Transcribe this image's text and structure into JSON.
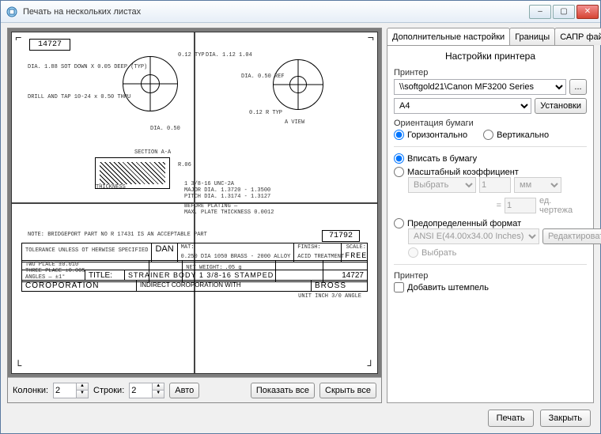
{
  "window": {
    "title": "Печать на нескольких листах"
  },
  "drawing": {
    "part_no_top": "14727",
    "part_no_right": "71792",
    "note": "NOTE: BRIDGEPORT PART NO R 17431 IS AN ACCEPTABLE PART",
    "title_label": "TITLE:",
    "title_value": "STRAINER BODY 1 3/8-16 STAMPED",
    "scale_label": "SCALE:",
    "free": "FREE",
    "finish_label": "FINISH:",
    "matl_label": "MAT:",
    "matl_value": "0.250 DIA 1050 BRASS - 2000 ALLOY",
    "weight_label": "NET WEIGHT:",
    "weight_value": ".05 g",
    "dan": "DAN",
    "corp": "COROPORATION",
    "indirect": "INDIRECT COROPORATION WITH",
    "bross": "BROSS",
    "part_no_bottom": "14727",
    "unit_note": "UNIT INCH 3/0 ANGLE",
    "tolerance": "TOLERANCE UNLESS OT HERWISE SPECIFIED",
    "two_place": "TWO PLACE ±0.010",
    "three_place": "THREE PLACE ±0.005",
    "angles": "ANGLES — ±1°",
    "acid": "ACID TREATMENT",
    "dim1": "DIA. 1.88 SOT DOWN X 0.05 DEEP (TYP)",
    "dim2": "0.12 TYP",
    "dim3": "DIA. 1.12  1.04",
    "dim4": "DIA. 0.50 REF",
    "dim5": "DRILL AND TAP 10-24 x 0.50 THRU",
    "dim6": "DIA. 0.50",
    "view_a": "A VIEW",
    "section": "SECTION A-A",
    "dim7": "0.12 R TYP",
    "dim8": "R.06",
    "thickness_lbl": "THICKNESS",
    "dim19": "1 3/8-16 UNC-2A",
    "dim20": "MAJOR DIA. 1.3720 - 1.3500",
    "dim21": "PITCH DIA. 1.3174 - 1.3127",
    "dim22": "BEFORE PLATING —",
    "dim23": "MAX. PLATE THICKNESS 0.0012"
  },
  "leftFooter": {
    "cols_label": "Колонки:",
    "cols_value": "2",
    "rows_label": "Строки:",
    "rows_value": "2",
    "auto": "Авто",
    "show_all": "Показать все",
    "hide_all": "Скрыть все"
  },
  "tabs": {
    "t1": "Дополнительные настройки",
    "t2": "Границы",
    "t3": "САПР файл"
  },
  "panel": {
    "heading": "Настройки принтера",
    "printer_label": "Принтер",
    "printer_value": "\\\\softgold21\\Canon MF3200 Series",
    "browse": "...",
    "paper_value": "A4",
    "setup_btn": "Установки",
    "orient_label": "Ориентация бумаги",
    "orient_h": "Горизонтально",
    "orient_v": "Вертикально",
    "fit": "Вписать в бумагу",
    "scalef": "Масштабный коэффициент",
    "sf_select": "Выбрать",
    "sf_one": "1",
    "sf_unit": "мм",
    "sf_eq": "=",
    "sf_unit2": "ед. чертежа",
    "predef": "Предопределенный формат",
    "predef_value": "ANSI E(44.00x34.00 Inches)",
    "edit_btn": "Редактировать",
    "choose": "Выбрать",
    "printer2_label": "Принтер",
    "stamp": "Добавить штемпель"
  },
  "footer": {
    "print": "Печать",
    "close": "Закрыть"
  }
}
